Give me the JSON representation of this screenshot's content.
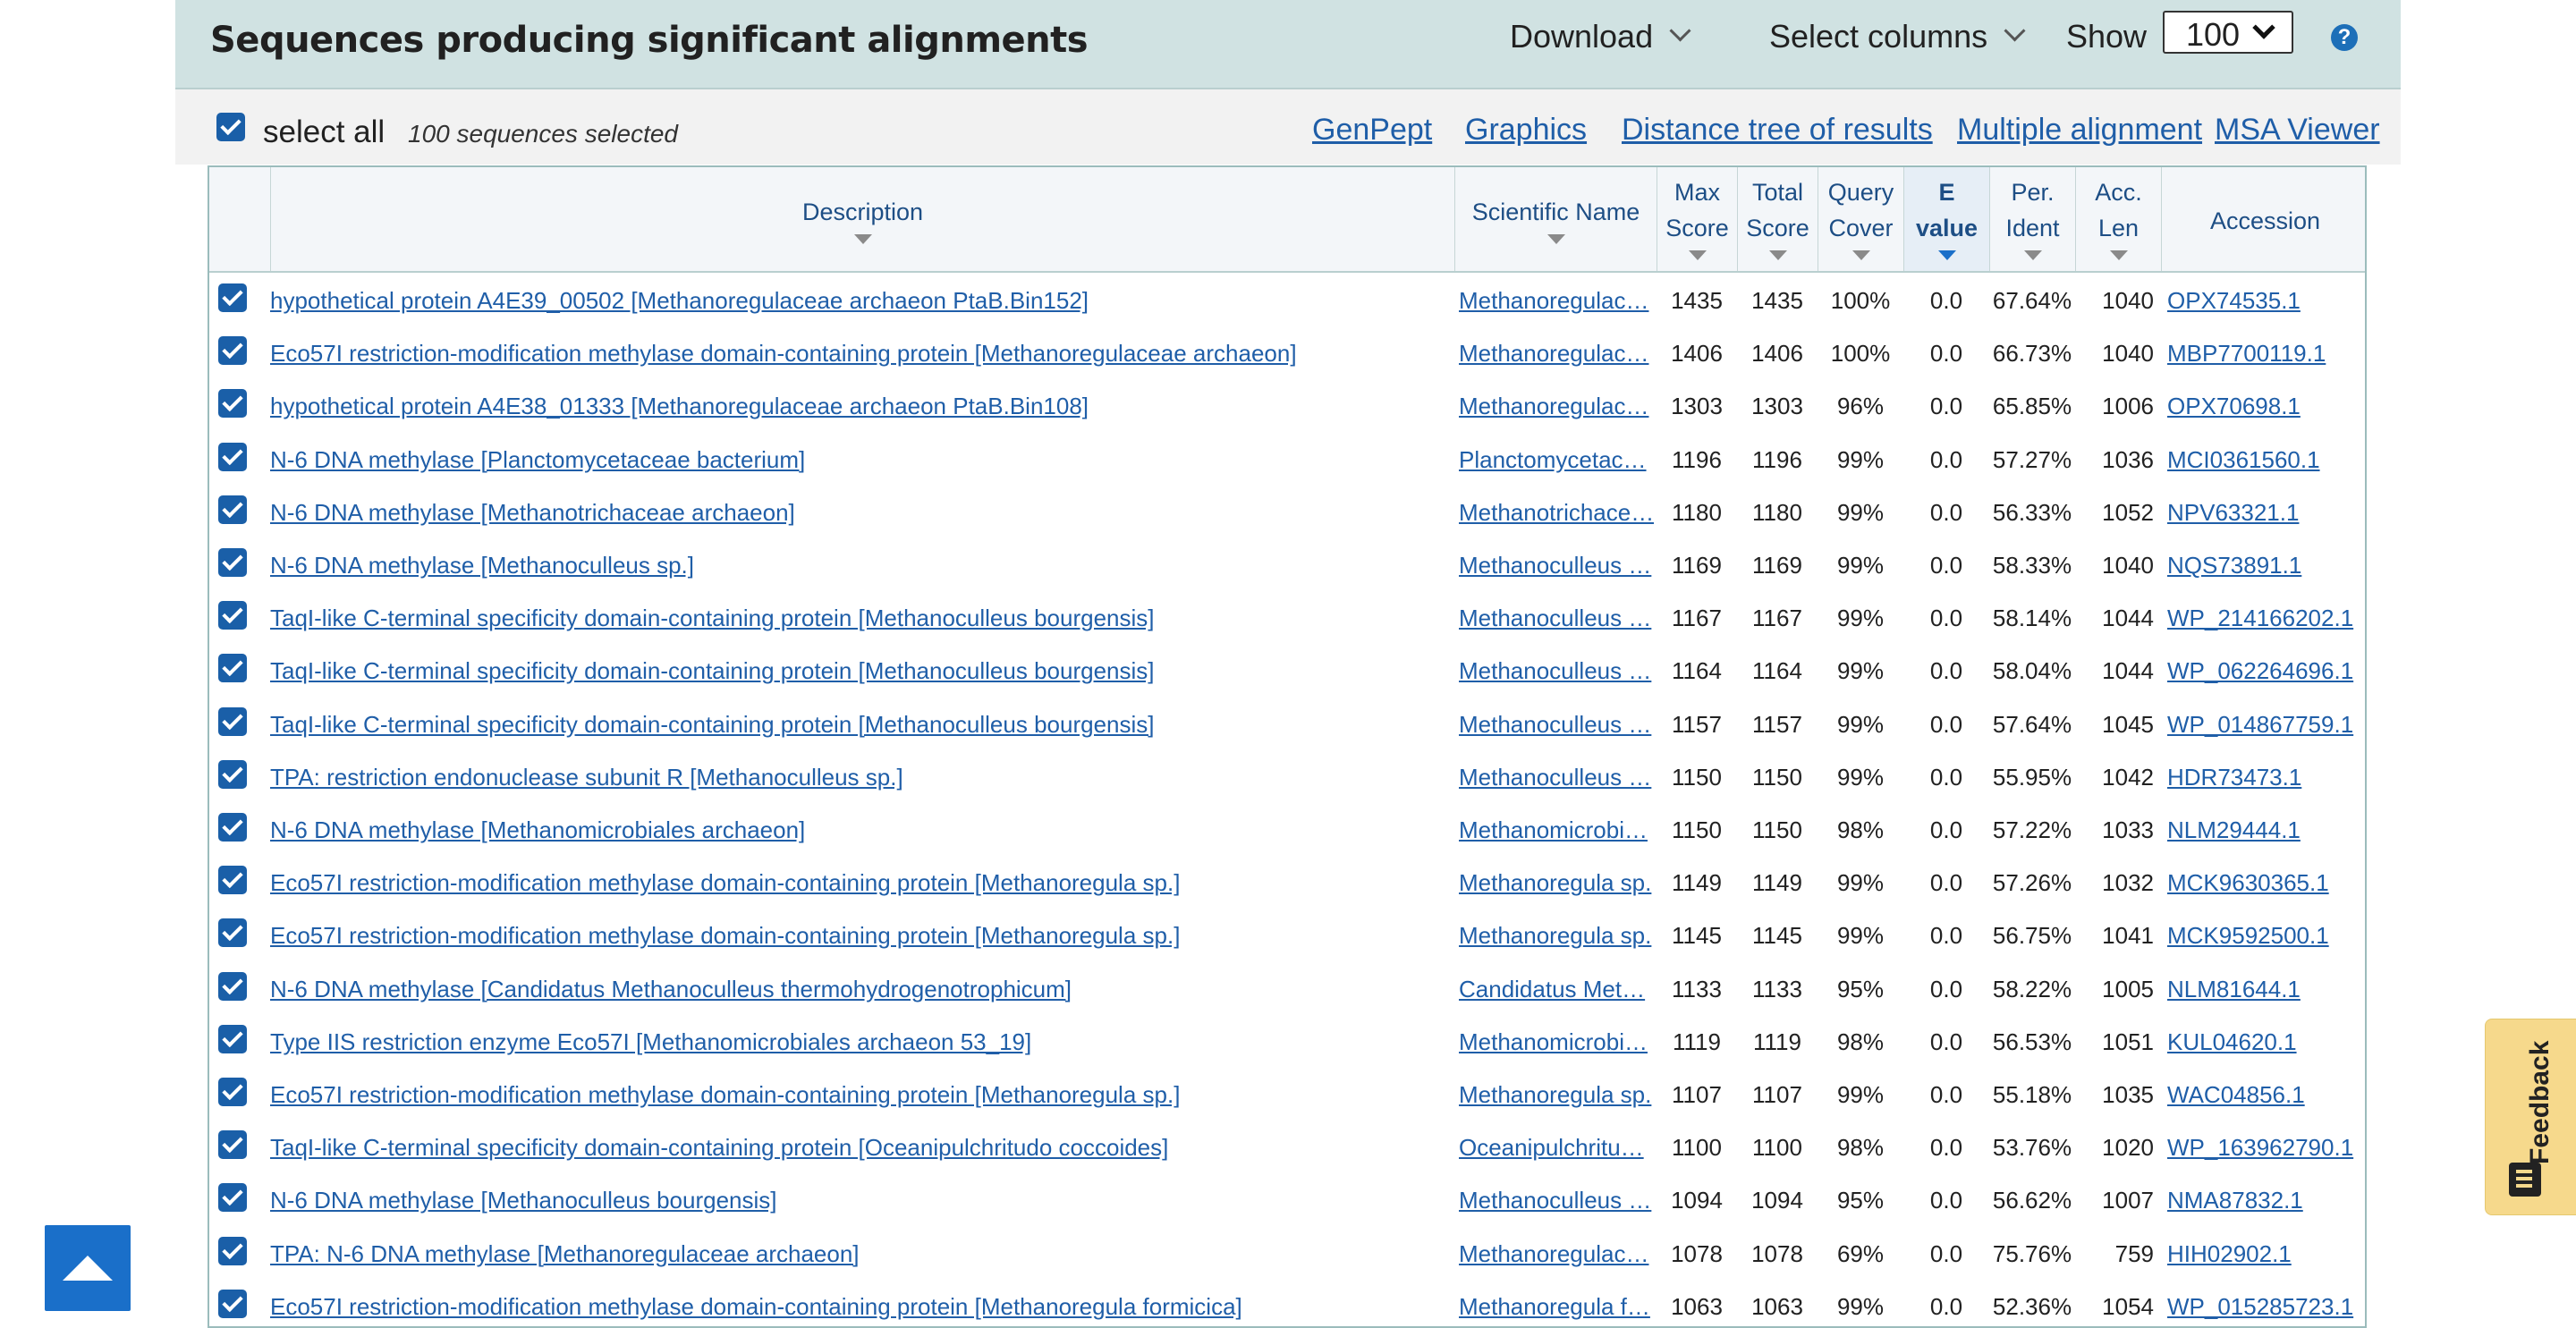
{
  "header": {
    "title": "Sequences producing significant alignments",
    "download_label": "Download",
    "select_columns_label": "Select columns",
    "show_label": "Show",
    "show_value": "100",
    "help_label": "?"
  },
  "subbar": {
    "select_all_label": "select all",
    "selected_count": "100 sequences selected",
    "links": [
      "GenPept",
      "Graphics",
      "Distance tree of results",
      "Multiple alignment",
      "MSA Viewer"
    ]
  },
  "columns": {
    "description": "Description",
    "scientific_name": "Scientific Name",
    "max_score_1": "Max",
    "max_score_2": "Score",
    "total_score_1": "Total",
    "total_score_2": "Score",
    "query_cover_1": "Query",
    "query_cover_2": "Cover",
    "evalue_1": "E",
    "evalue_2": "value",
    "per_ident_1": "Per.",
    "per_ident_2": "Ident",
    "acc_len_1": "Acc.",
    "acc_len_2": "Len",
    "accession": "Accession"
  },
  "rows": [
    {
      "desc": "hypothetical protein A4E39_00502 [Methanoregulaceae archaeon PtaB.Bin152]",
      "sci": "Methanoregulac…",
      "max": "1435",
      "total": "1435",
      "cover": "100%",
      "evalue": "0.0",
      "ident": "67.64%",
      "len": "1040",
      "acc": "OPX74535.1"
    },
    {
      "desc": "Eco57I restriction-modification methylase domain-containing protein [Methanoregulaceae archaeon]",
      "sci": "Methanoregulac…",
      "max": "1406",
      "total": "1406",
      "cover": "100%",
      "evalue": "0.0",
      "ident": "66.73%",
      "len": "1040",
      "acc": "MBP7700119.1"
    },
    {
      "desc": "hypothetical protein A4E38_01333 [Methanoregulaceae archaeon PtaB.Bin108]",
      "sci": "Methanoregulac…",
      "max": "1303",
      "total": "1303",
      "cover": "96%",
      "evalue": "0.0",
      "ident": "65.85%",
      "len": "1006",
      "acc": "OPX70698.1"
    },
    {
      "desc": "N-6 DNA methylase [Planctomycetaceae bacterium]",
      "sci": "Planctomycetac…",
      "max": "1196",
      "total": "1196",
      "cover": "99%",
      "evalue": "0.0",
      "ident": "57.27%",
      "len": "1036",
      "acc": "MCI0361560.1"
    },
    {
      "desc": "N-6 DNA methylase [Methanotrichaceae archaeon]",
      "sci": "Methanotrichace…",
      "max": "1180",
      "total": "1180",
      "cover": "99%",
      "evalue": "0.0",
      "ident": "56.33%",
      "len": "1052",
      "acc": "NPV63321.1"
    },
    {
      "desc": "N-6 DNA methylase [Methanoculleus sp.]",
      "sci": "Methanoculleus …",
      "max": "1169",
      "total": "1169",
      "cover": "99%",
      "evalue": "0.0",
      "ident": "58.33%",
      "len": "1040",
      "acc": "NQS73891.1"
    },
    {
      "desc": "TaqI-like C-terminal specificity domain-containing protein [Methanoculleus bourgensis]",
      "sci": "Methanoculleus …",
      "max": "1167",
      "total": "1167",
      "cover": "99%",
      "evalue": "0.0",
      "ident": "58.14%",
      "len": "1044",
      "acc": "WP_214166202.1"
    },
    {
      "desc": "TaqI-like C-terminal specificity domain-containing protein [Methanoculleus bourgensis]",
      "sci": "Methanoculleus …",
      "max": "1164",
      "total": "1164",
      "cover": "99%",
      "evalue": "0.0",
      "ident": "58.04%",
      "len": "1044",
      "acc": "WP_062264696.1"
    },
    {
      "desc": "TaqI-like C-terminal specificity domain-containing protein [Methanoculleus bourgensis]",
      "sci": "Methanoculleus …",
      "max": "1157",
      "total": "1157",
      "cover": "99%",
      "evalue": "0.0",
      "ident": "57.64%",
      "len": "1045",
      "acc": "WP_014867759.1"
    },
    {
      "desc": "TPA: restriction endonuclease subunit R [Methanoculleus sp.]",
      "sci": "Methanoculleus …",
      "max": "1150",
      "total": "1150",
      "cover": "99%",
      "evalue": "0.0",
      "ident": "55.95%",
      "len": "1042",
      "acc": "HDR73473.1"
    },
    {
      "desc": "N-6 DNA methylase [Methanomicrobiales archaeon]",
      "sci": "Methanomicrobi…",
      "max": "1150",
      "total": "1150",
      "cover": "98%",
      "evalue": "0.0",
      "ident": "57.22%",
      "len": "1033",
      "acc": "NLM29444.1"
    },
    {
      "desc": "Eco57I restriction-modification methylase domain-containing protein [Methanoregula sp.]",
      "sci": "Methanoregula sp.",
      "max": "1149",
      "total": "1149",
      "cover": "99%",
      "evalue": "0.0",
      "ident": "57.26%",
      "len": "1032",
      "acc": "MCK9630365.1"
    },
    {
      "desc": "Eco57I restriction-modification methylase domain-containing protein [Methanoregula sp.]",
      "sci": "Methanoregula sp.",
      "max": "1145",
      "total": "1145",
      "cover": "99%",
      "evalue": "0.0",
      "ident": "56.75%",
      "len": "1041",
      "acc": "MCK9592500.1"
    },
    {
      "desc": "N-6 DNA methylase [Candidatus Methanoculleus thermohydrogenotrophicum]",
      "sci": "Candidatus Met…",
      "max": "1133",
      "total": "1133",
      "cover": "95%",
      "evalue": "0.0",
      "ident": "58.22%",
      "len": "1005",
      "acc": "NLM81644.1"
    },
    {
      "desc": "Type IIS restriction enzyme Eco57I [Methanomicrobiales archaeon 53_19]",
      "sci": "Methanomicrobi…",
      "max": "1119",
      "total": "1119",
      "cover": "98%",
      "evalue": "0.0",
      "ident": "56.53%",
      "len": "1051",
      "acc": "KUL04620.1"
    },
    {
      "desc": "Eco57I restriction-modification methylase domain-containing protein [Methanoregula sp.]",
      "sci": "Methanoregula sp.",
      "max": "1107",
      "total": "1107",
      "cover": "99%",
      "evalue": "0.0",
      "ident": "55.18%",
      "len": "1035",
      "acc": "WAC04856.1"
    },
    {
      "desc": "TaqI-like C-terminal specificity domain-containing protein [Oceanipulchritudo coccoides]",
      "sci": "Oceanipulchritu…",
      "max": "1100",
      "total": "1100",
      "cover": "98%",
      "evalue": "0.0",
      "ident": "53.76%",
      "len": "1020",
      "acc": "WP_163962790.1"
    },
    {
      "desc": "N-6 DNA methylase [Methanoculleus bourgensis]",
      "sci": "Methanoculleus …",
      "max": "1094",
      "total": "1094",
      "cover": "95%",
      "evalue": "0.0",
      "ident": "56.62%",
      "len": "1007",
      "acc": "NMA87832.1"
    },
    {
      "desc": "TPA: N-6 DNA methylase [Methanoregulaceae archaeon]",
      "sci": "Methanoregulac…",
      "max": "1078",
      "total": "1078",
      "cover": "69%",
      "evalue": "0.0",
      "ident": "75.76%",
      "len": "759",
      "acc": "HIH02902.1"
    },
    {
      "desc": "Eco57I restriction-modification methylase domain-containing protein [Methanoregula formicica]",
      "sci": "Methanoregula f…",
      "max": "1063",
      "total": "1063",
      "cover": "99%",
      "evalue": "0.0",
      "ident": "52.36%",
      "len": "1054",
      "acc": "WP_015285723.1"
    }
  ],
  "feedback": {
    "label": "Feedback"
  },
  "colors": {
    "header_bg": "#d0e2e2",
    "link": "#1f5ea8",
    "checkbox": "#1a5fa8",
    "feedback_bg": "#f6d98c"
  }
}
